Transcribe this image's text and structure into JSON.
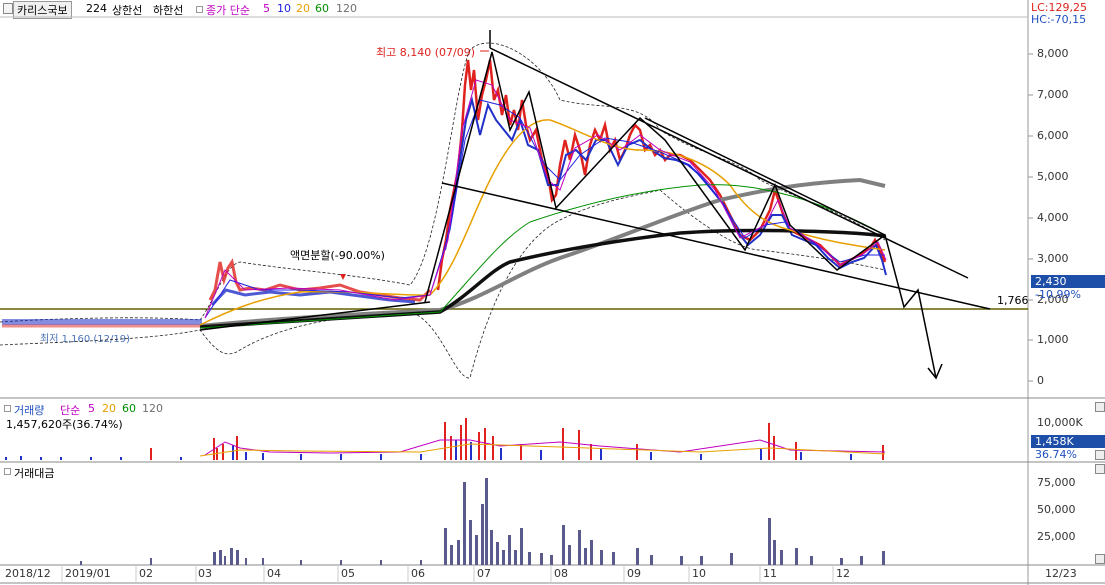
{
  "header": {
    "stock_name": "카리스국보",
    "code": "224",
    "upper_limit": "상한선",
    "lower_limit": "하한선",
    "ma_title": "종가 단순",
    "ma_periods": [
      "5",
      "10",
      "20",
      "60",
      "120"
    ]
  },
  "price_panel": {
    "lc": "LC:129,25",
    "hc": "HC:-70,15",
    "y_ticks": [
      "8,000",
      "7,000",
      "6,000",
      "5,000",
      "4,000",
      "3,000",
      "2,000",
      "1,000",
      "0"
    ],
    "current_price": "2,430",
    "current_change": "-10.99%",
    "support_value": "1,766",
    "high_annotation": "최고 8,140 (07/09)",
    "low_annotation": "최저 1,160 (12/19)",
    "split_annotation": "액면분할(-90.00%)"
  },
  "volume_panel": {
    "title": "거래량",
    "ma_title": "단순",
    "ma_periods": [
      "5",
      "20",
      "60",
      "120"
    ],
    "value": "1,457,620주(36.74%)",
    "y_tick": "10,000K",
    "current": "1,458K",
    "percent": "36.74%"
  },
  "amount_panel": {
    "title": "거래대금",
    "y_ticks": [
      "75,000",
      "50,000",
      "25,000"
    ]
  },
  "x_axis": [
    "2018/12",
    "2019/01",
    "02",
    "03",
    "04",
    "05",
    "06",
    "07",
    "08",
    "09",
    "10",
    "11",
    "12"
  ],
  "x_axis_right": "12/23",
  "colors": {
    "up": "#e0221e",
    "down": "#2030c8",
    "ma5": "#c000c0",
    "ma10": "#2020e0",
    "ma20": "#e8a000",
    "ma60": "#009000",
    "ma120": "#707070",
    "label_blue": "#1e4fa8"
  }
}
